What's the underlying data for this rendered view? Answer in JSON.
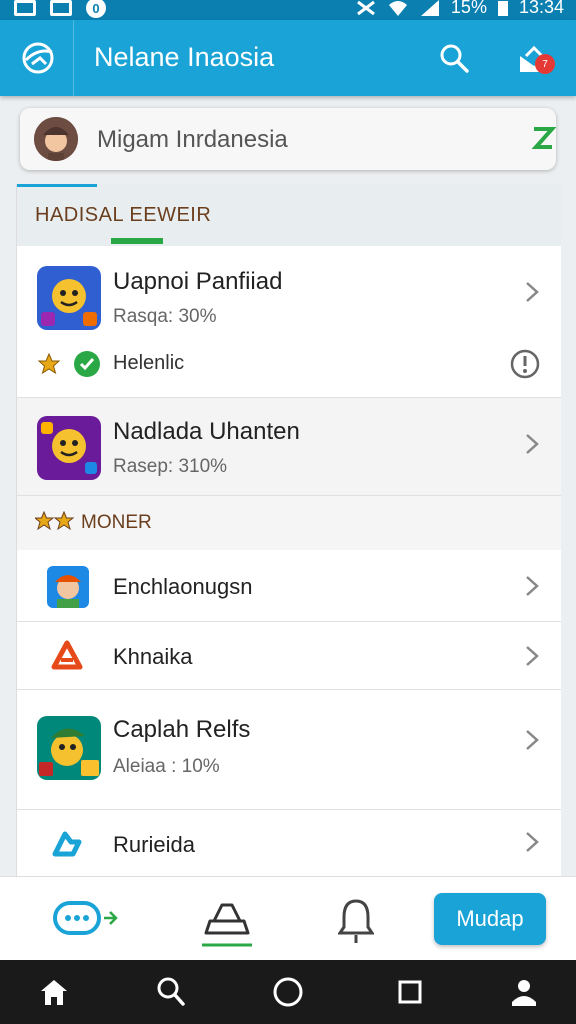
{
  "status_bar": {
    "battery": "15%",
    "time": "13:34"
  },
  "app_bar": {
    "title": "Nelane Inaosia",
    "notification_count": "7"
  },
  "profile": {
    "name": "Migam Inrdanesia"
  },
  "section": {
    "title": "HADISAL EEWEIR"
  },
  "items": [
    {
      "title": "Uapnoi Panfiiad",
      "subtitle": "Rasqa: 30%",
      "status_label": "Helenlic"
    },
    {
      "title": "Nadlada Uhanten",
      "subtitle": "Rasep: 310%"
    },
    {
      "title": "Enchlaonugsn"
    },
    {
      "title": "Khnaika"
    },
    {
      "title": "Caplah Relfs",
      "subtitle": "Aleiaa : 10%"
    },
    {
      "title": "Rurieida"
    }
  ],
  "subsection": {
    "title": "MONER"
  },
  "bottom_bar": {
    "action_label": "Mudap"
  },
  "colors": {
    "primary": "#1aa3d6",
    "accent_green": "#2aa845",
    "section_text": "#6b3e1e"
  }
}
